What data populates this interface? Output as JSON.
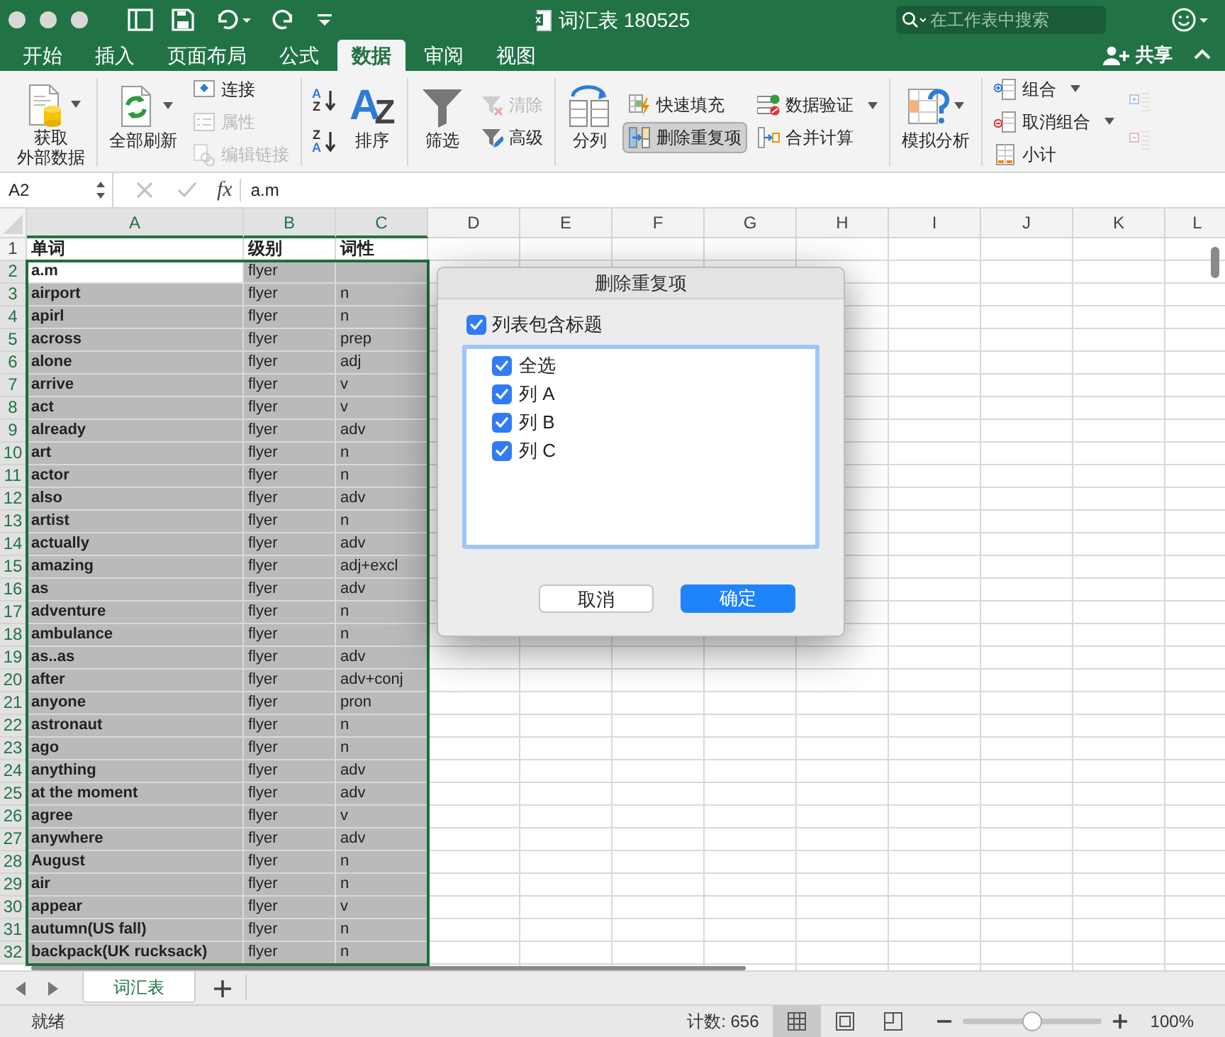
{
  "window": {
    "title": "词汇表 180525",
    "search_placeholder": "在工作表中搜索",
    "share": "共享"
  },
  "ribbon_tabs": [
    {
      "label": "开始",
      "selected": false
    },
    {
      "label": "插入",
      "selected": false
    },
    {
      "label": "页面布局",
      "selected": false
    },
    {
      "label": "公式",
      "selected": false
    },
    {
      "label": "数据",
      "selected": true
    },
    {
      "label": "审阅",
      "selected": false
    },
    {
      "label": "视图",
      "selected": false
    }
  ],
  "ribbon": [
    {
      "columns": [
        {
          "kind": "large",
          "lines": [
            "获取",
            "外部数据"
          ],
          "dropdown": true,
          "disabled": false,
          "pressed": false
        }
      ]
    },
    {
      "columns": [
        {
          "kind": "large",
          "lines": [
            "全部刷新"
          ],
          "dropdown": true,
          "disabled": false,
          "pressed": false
        },
        {
          "kind": "stack",
          "items": [
            {
              "kind": "small",
              "label": "连接",
              "dropdown": false,
              "disabled": false,
              "pressed": false
            },
            {
              "kind": "small",
              "label": "属性",
              "dropdown": false,
              "disabled": true,
              "pressed": false
            },
            {
              "kind": "small",
              "label": "编辑链接",
              "dropdown": false,
              "disabled": true,
              "pressed": false
            }
          ]
        }
      ]
    },
    {
      "columns": [
        {
          "kind": "stack",
          "items": [
            {
              "kind": "sort",
              "glyphs": [
                "A",
                "Z"
              ],
              "disabled": false,
              "pressed": false
            },
            {
              "kind": "sort",
              "glyphs": [
                "Z",
                "A"
              ],
              "disabled": false,
              "pressed": false
            }
          ]
        },
        {
          "kind": "large",
          "glyphs": [
            "A",
            "Z"
          ],
          "lines": [
            "排序"
          ],
          "dropdown": false,
          "disabled": false,
          "pressed": false
        }
      ]
    },
    {
      "columns": [
        {
          "kind": "large",
          "lines": [
            "筛选"
          ],
          "dropdown": false,
          "disabled": false,
          "pressed": false
        },
        {
          "kind": "stack",
          "items": [
            {
              "kind": "small",
              "label": "清除",
              "dropdown": false,
              "disabled": true,
              "pressed": false
            },
            {
              "kind": "small",
              "label": "高级",
              "dropdown": false,
              "disabled": false,
              "pressed": false
            }
          ]
        }
      ]
    },
    {
      "columns": [
        {
          "kind": "large",
          "lines": [
            "分列"
          ],
          "dropdown": false,
          "disabled": false,
          "pressed": false
        },
        {
          "kind": "stack",
          "items": [
            {
              "kind": "small",
              "label": "快速填充",
              "dropdown": false,
              "disabled": false,
              "pressed": false
            },
            {
              "kind": "small",
              "label": "删除重复项",
              "dropdown": false,
              "disabled": false,
              "pressed": true
            }
          ]
        },
        {
          "kind": "stack",
          "items": [
            {
              "kind": "small",
              "label": "数据验证",
              "dropdown": true,
              "disabled": false,
              "pressed": false
            },
            {
              "kind": "small",
              "label": "合并计算",
              "dropdown": false,
              "disabled": false,
              "pressed": false
            }
          ]
        }
      ]
    },
    {
      "columns": [
        {
          "kind": "large",
          "lines": [
            "模拟分析"
          ],
          "dropdown": true,
          "disabled": false,
          "pressed": false
        }
      ]
    },
    {
      "columns": [
        {
          "kind": "stack",
          "items": [
            {
              "kind": "small",
              "label": "组合",
              "dropdown": true,
              "disabled": false,
              "pressed": false
            },
            {
              "kind": "small",
              "label": "取消组合",
              "dropdown": true,
              "disabled": false,
              "pressed": false
            },
            {
              "kind": "small",
              "label": "小计",
              "dropdown": false,
              "disabled": false,
              "pressed": false
            }
          ]
        },
        {
          "kind": "stack",
          "items": [
            {
              "kind": "icon",
              "disabled": true,
              "pressed": false
            },
            {
              "kind": "icon",
              "disabled": true,
              "pressed": false
            }
          ]
        }
      ]
    }
  ],
  "formula_bar": {
    "name_box": "A2",
    "function_label": "fx",
    "value": "a.m"
  },
  "columns": [
    {
      "label": "A",
      "selected": true
    },
    {
      "label": "B",
      "selected": true
    },
    {
      "label": "C",
      "selected": true
    },
    {
      "label": "D",
      "selected": false
    },
    {
      "label": "E",
      "selected": false
    },
    {
      "label": "F",
      "selected": false
    },
    {
      "label": "G",
      "selected": false
    },
    {
      "label": "H",
      "selected": false
    },
    {
      "label": "I",
      "selected": false
    },
    {
      "label": "J",
      "selected": false
    },
    {
      "label": "K",
      "selected": false
    },
    {
      "label": "L",
      "selected": false
    }
  ],
  "header_row": {
    "number": "1",
    "a": "单词",
    "b": "级别",
    "c": "词性"
  },
  "rows": [
    {
      "number": "2",
      "a": "a.m",
      "b": "flyer",
      "selected": true,
      "active": true
    },
    {
      "number": "3",
      "a": "airport",
      "b": "flyer",
      "c": "n",
      "selected": true,
      "active": false
    },
    {
      "number": "4",
      "a": "apirl",
      "b": "flyer",
      "c": "n",
      "selected": true,
      "active": false
    },
    {
      "number": "5",
      "a": "across",
      "b": "flyer",
      "c": "prep",
      "selected": true,
      "active": false
    },
    {
      "number": "6",
      "a": "alone",
      "b": "flyer",
      "c": "adj",
      "selected": true,
      "active": false
    },
    {
      "number": "7",
      "a": "arrive",
      "b": "flyer",
      "c": "v",
      "selected": true,
      "active": false
    },
    {
      "number": "8",
      "a": "act",
      "b": "flyer",
      "c": "v",
      "selected": true,
      "active": false
    },
    {
      "number": "9",
      "a": "already",
      "b": "flyer",
      "c": "adv",
      "selected": true,
      "active": false
    },
    {
      "number": "10",
      "a": "art",
      "b": "flyer",
      "c": "n",
      "selected": true,
      "active": false
    },
    {
      "number": "11",
      "a": "actor",
      "b": "flyer",
      "c": "n",
      "selected": true,
      "active": false
    },
    {
      "number": "12",
      "a": "also",
      "b": "flyer",
      "c": "adv",
      "selected": true,
      "active": false
    },
    {
      "number": "13",
      "a": "artist",
      "b": "flyer",
      "c": "n",
      "selected": true,
      "active": false
    },
    {
      "number": "14",
      "a": "actually",
      "b": "flyer",
      "c": "adv",
      "selected": true,
      "active": false
    },
    {
      "number": "15",
      "a": "amazing",
      "b": "flyer",
      "c": "adj+excl",
      "selected": true,
      "active": false
    },
    {
      "number": "16",
      "a": "as",
      "b": "flyer",
      "c": "adv",
      "selected": true,
      "active": false
    },
    {
      "number": "17",
      "a": "adventure",
      "b": "flyer",
      "c": "n",
      "selected": true,
      "active": false
    },
    {
      "number": "18",
      "a": "ambulance",
      "b": "flyer",
      "c": "n",
      "selected": true,
      "active": false
    },
    {
      "number": "19",
      "a": "as..as",
      "b": "flyer",
      "c": "adv",
      "selected": true,
      "active": false
    },
    {
      "number": "20",
      "a": "after",
      "b": "flyer",
      "c": "adv+conj",
      "selected": true,
      "active": false
    },
    {
      "number": "21",
      "a": "anyone",
      "b": "flyer",
      "c": "pron",
      "selected": true,
      "active": false
    },
    {
      "number": "22",
      "a": "astronaut",
      "b": "flyer",
      "c": "n",
      "selected": true,
      "active": false
    },
    {
      "number": "23",
      "a": "ago",
      "b": "flyer",
      "c": "n",
      "selected": true,
      "active": false
    },
    {
      "number": "24",
      "a": "anything",
      "b": "flyer",
      "c": "adv",
      "selected": true,
      "active": false
    },
    {
      "number": "25",
      "a": "at the moment",
      "b": "flyer",
      "c": "adv",
      "selected": true,
      "active": false
    },
    {
      "number": "26",
      "a": "agree",
      "b": "flyer",
      "c": "v",
      "selected": true,
      "active": false
    },
    {
      "number": "27",
      "a": "anywhere",
      "b": "flyer",
      "c": "adv",
      "selected": true,
      "active": false
    },
    {
      "number": "28",
      "a": "August",
      "b": "flyer",
      "c": "n",
      "selected": true,
      "active": false
    },
    {
      "number": "29",
      "a": "air",
      "b": "flyer",
      "c": "n",
      "selected": true,
      "active": false
    },
    {
      "number": "30",
      "a": "appear",
      "b": "flyer",
      "c": "v",
      "selected": true,
      "active": false
    },
    {
      "number": "31",
      "a": "autumn(US fall)",
      "b": "flyer",
      "c": "n",
      "selected": true,
      "active": false
    },
    {
      "number": "32",
      "a": "backpack(UK rucksack)",
      "b": "flyer",
      "c": "n",
      "selected": true,
      "active": false
    }
  ],
  "dialog": {
    "title": "删除重复项",
    "has_headers": {
      "label": "列表包含标题",
      "checked": true
    },
    "columns": [
      {
        "label": "全选",
        "checked": true
      },
      {
        "label": "列 A",
        "checked": true
      },
      {
        "label": "列 B",
        "checked": true
      },
      {
        "label": "列 C",
        "checked": true
      }
    ],
    "buttons": [
      {
        "label": "取消",
        "kind": "secondary"
      },
      {
        "label": "确定",
        "kind": "primary"
      }
    ]
  },
  "sheet_tabs": [
    {
      "label": "词汇表",
      "selected": true
    }
  ],
  "status_bar": {
    "status": "就绪",
    "count": "计数: 656",
    "views": [
      {
        "kind": "normal",
        "selected": true
      },
      {
        "kind": "page_layout",
        "selected": false
      },
      {
        "kind": "page_break",
        "selected": false
      }
    ],
    "zoom": {
      "level": 0.5,
      "label": "100%"
    }
  }
}
